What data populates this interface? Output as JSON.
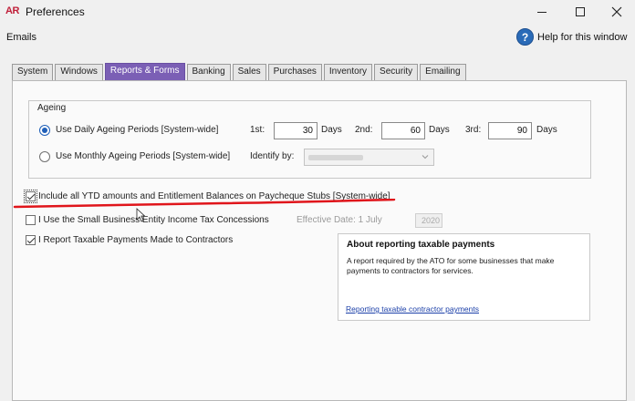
{
  "window": {
    "logo": "AR",
    "title": "Preferences"
  },
  "menubar": {
    "emails_label": "Emails",
    "help_icon_glyph": "?",
    "help_label": "Help for this window"
  },
  "tabs": [
    {
      "label": "System"
    },
    {
      "label": "Windows"
    },
    {
      "label": "Reports & Forms",
      "active": true
    },
    {
      "label": "Banking"
    },
    {
      "label": "Sales"
    },
    {
      "label": "Purchases"
    },
    {
      "label": "Inventory"
    },
    {
      "label": "Security"
    },
    {
      "label": "Emailing"
    }
  ],
  "ageing": {
    "group_label": "Ageing",
    "daily_option": "Use Daily Ageing Periods [System-wide]",
    "monthly_option": "Use Monthly Ageing Periods [System-wide]",
    "selected": "daily",
    "first_label": "1st:",
    "first_value": "30",
    "second_label": "2nd:",
    "second_value": "60",
    "third_label": "3rd:",
    "third_value": "90",
    "days_label": "Days",
    "identify_label": "Identify by:"
  },
  "options": {
    "ytd_label": "Include all YTD amounts and Entitlement Balances on Paycheque Stubs [System-wide]",
    "ytd_checked": true,
    "small_business_label": "I Use the Small Business Entity Income Tax Concessions",
    "small_business_checked": false,
    "effective_date_label": "Effective Date: 1 July",
    "effective_year": "2020",
    "taxable_payments_label": "I Report Taxable Payments Made to Contractors",
    "taxable_payments_checked": true
  },
  "info": {
    "title": "About reporting taxable payments",
    "body": "A report required by the ATO for some businesses that make payments to contractors for services.",
    "link": "Reporting taxable contractor payments"
  },
  "colors": {
    "active_tab": "#7b5fb5",
    "annotation_red": "#e0151b",
    "link": "#1b3fa8",
    "help_icon": "#2a6bb8"
  }
}
